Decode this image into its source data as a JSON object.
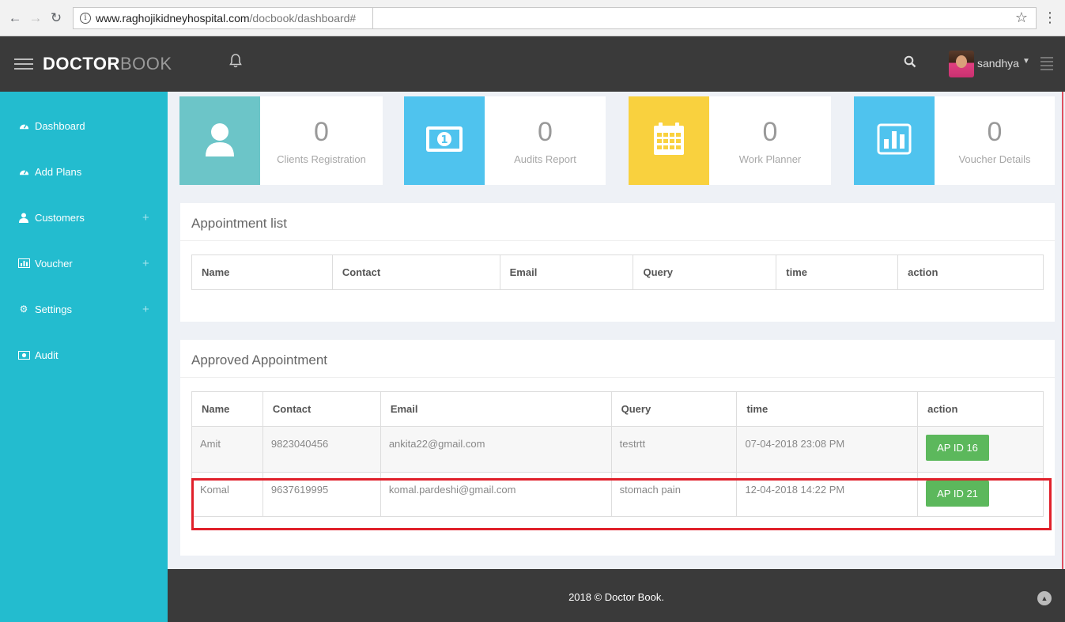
{
  "browser": {
    "url_host": "www.raghojikidneyhospital.com",
    "url_path": "/docbook/dashboard#"
  },
  "header": {
    "brand_bold": "DOCTOR",
    "brand_light": "BOOK",
    "user_name": "sandhya"
  },
  "sidebar": {
    "items": [
      {
        "label": "Dashboard",
        "icon": "dashboard-icon",
        "expandable": false
      },
      {
        "label": "Add Plans",
        "icon": "dashboard-icon",
        "expandable": false
      },
      {
        "label": "Customers",
        "icon": "user-icon",
        "expandable": true
      },
      {
        "label": "Voucher",
        "icon": "bar-chart-icon",
        "expandable": true
      },
      {
        "label": "Settings",
        "icon": "gear-icon",
        "expandable": true
      },
      {
        "label": "Audit",
        "icon": "money-icon",
        "expandable": false
      }
    ]
  },
  "stats": [
    {
      "count": "0",
      "label": "Clients Registration",
      "color": "#6cc5c8",
      "icon": "user-icon"
    },
    {
      "count": "0",
      "label": "Audits Report",
      "color": "#4fc3ee",
      "icon": "money-icon"
    },
    {
      "count": "0",
      "label": "Work Planner",
      "color": "#f9d13e",
      "icon": "calendar-icon"
    },
    {
      "count": "0",
      "label": "Voucher Details",
      "color": "#4fc3ee",
      "icon": "bar-chart-icon"
    }
  ],
  "appointment_list": {
    "title": "Appointment list",
    "columns": [
      "Name",
      "Contact",
      "Email",
      "Query",
      "time",
      "action"
    ]
  },
  "approved": {
    "title": "Approved Appointment",
    "columns": [
      "Name",
      "Contact",
      "Email",
      "Query",
      "time",
      "action"
    ],
    "rows": [
      {
        "name": "Amit",
        "contact": "9823040456",
        "email": "ankita22@gmail.com",
        "query": "testrtt",
        "time": "07-04-2018 23:08 PM",
        "action": "AP ID 16"
      },
      {
        "name": "Komal",
        "contact": "9637619995",
        "email": "komal.pardeshi@gmail.com",
        "query": "stomach pain",
        "time": "12-04-2018 14:22 PM",
        "action": "AP ID 21"
      }
    ]
  },
  "footer": {
    "text": "2018 © Doctor Book."
  }
}
